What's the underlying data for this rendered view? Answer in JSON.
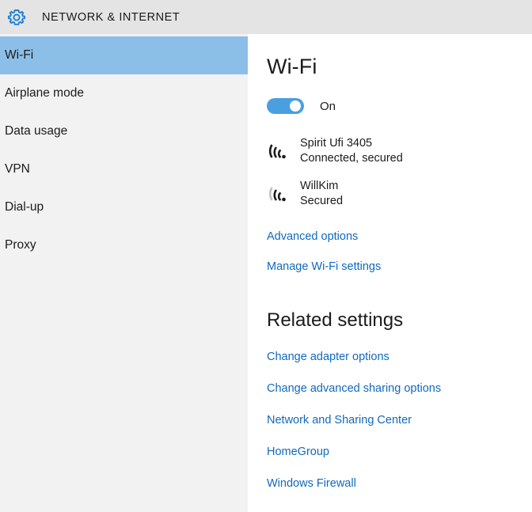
{
  "header": {
    "icon": "gear-icon",
    "title": "NETWORK & INTERNET"
  },
  "sidebar": {
    "items": [
      {
        "label": "Wi-Fi",
        "selected": true
      },
      {
        "label": "Airplane mode",
        "selected": false
      },
      {
        "label": "Data usage",
        "selected": false
      },
      {
        "label": "VPN",
        "selected": false
      },
      {
        "label": "Dial-up",
        "selected": false
      },
      {
        "label": "Proxy",
        "selected": false
      }
    ]
  },
  "main": {
    "page_title": "Wi-Fi",
    "toggle": {
      "state_label": "On",
      "on": true
    },
    "networks": [
      {
        "name": "Spirit Ufi 3405",
        "status": "Connected, secured",
        "icon": "wifi-signal-icon",
        "signal_bars": 4
      },
      {
        "name": "WillKim",
        "status": "Secured",
        "icon": "wifi-signal-icon",
        "signal_bars": 3
      }
    ],
    "wifi_links": [
      {
        "label": "Advanced options"
      },
      {
        "label": "Manage Wi-Fi settings"
      }
    ],
    "related_settings": {
      "heading": "Related settings",
      "links": [
        {
          "label": "Change adapter options"
        },
        {
          "label": "Change advanced sharing options"
        },
        {
          "label": "Network and Sharing Center"
        },
        {
          "label": "HomeGroup"
        },
        {
          "label": "Windows Firewall"
        }
      ]
    }
  },
  "colors": {
    "header_bg": "#e4e4e4",
    "sidebar_bg": "#f2f2f2",
    "selected_bg": "#8cbfe8",
    "accent_blue": "#1069bf",
    "toggle_on": "#4a9fe0",
    "gear_blue": "#1e7fd4"
  }
}
